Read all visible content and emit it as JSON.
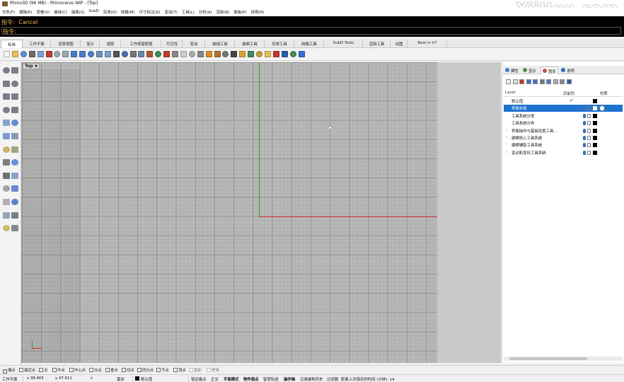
{
  "window": {
    "title": "Rhino3D (96 MB) - Rhinoceros WIP - [Top]"
  },
  "watermark": "YiiHuu.com",
  "menu": [
    "文件(F)",
    "编辑(E)",
    "查看(V)",
    "曲线(C)",
    "曲面(S)",
    "SubD",
    "实体(O)",
    "网格(M)",
    "尺寸标注(D)",
    "变动(T)",
    "工具(L)",
    "分析(A)",
    "渲染(R)",
    "面板(P)",
    "说明(H)"
  ],
  "command": {
    "history_prefix": "指令:",
    "history_text": "Cancel",
    "prompt_prefix": "指令:"
  },
  "tabs": [
    {
      "label": "标准",
      "active": true
    },
    {
      "label": "工作平面"
    },
    {
      "label": "设置视图"
    },
    {
      "label": "显示"
    },
    {
      "label": "选取"
    },
    {
      "label": "工作视窗配置"
    },
    {
      "label": "可见性"
    },
    {
      "label": "变动"
    },
    {
      "label": "曲线工具"
    },
    {
      "label": "曲面工具"
    },
    {
      "label": "实体工具"
    },
    {
      "label": "网格工具"
    },
    {
      "label": "SubD Tools"
    },
    {
      "label": "渲染工具"
    },
    {
      "label": "出图"
    },
    {
      "label": "New in V7"
    }
  ],
  "viewport": {
    "name": "Top"
  },
  "panel": {
    "tabs": [
      {
        "label": "属性",
        "color": "#3d7fcf"
      },
      {
        "label": "显示",
        "color": "#5a8b3a"
      },
      {
        "label": "图层",
        "color": "#c0504d",
        "active": true
      },
      {
        "label": "说明",
        "color": "#2a6db5"
      }
    ],
    "header": {
      "layer": "Layer",
      "current": "目前的",
      "material": "材质"
    },
    "layers": [
      {
        "name": "默认值",
        "current": true,
        "expand": ""
      },
      {
        "name": "界面布局",
        "selected": true,
        "expand": ""
      },
      {
        "name": "工具系统分类",
        "expand": ""
      },
      {
        "name": "工具系统分布",
        "expand": ""
      },
      {
        "name": "界面操作与基础设置工具...",
        "expand": "›"
      },
      {
        "name": "建模核心工具系统",
        "expand": "›"
      },
      {
        "name": "建模辅助工具系统",
        "expand": "›"
      },
      {
        "name": "变动和变形工具系统",
        "expand": "›"
      }
    ],
    "current_mark": "✓"
  },
  "osnap": [
    {
      "label": "端点",
      "checked": true
    },
    {
      "label": "最近点"
    },
    {
      "label": "点"
    },
    {
      "label": "中点"
    },
    {
      "label": "中心点"
    },
    {
      "label": "交点"
    },
    {
      "label": "垂点"
    },
    {
      "label": "切点"
    },
    {
      "label": "四分点"
    },
    {
      "label": "节点"
    },
    {
      "label": "顶点"
    },
    {
      "label": "投影"
    },
    {
      "label": "停用"
    }
  ],
  "status": {
    "cplane": "工作平面",
    "x": "x 38.465",
    "y": "y 47.611",
    "z": "z",
    "units": "毫米",
    "layer": "默认值",
    "modes": [
      "锁定格点",
      "正交",
      "平面模式",
      "物件锁点",
      "智慧轨迹",
      "操作轴",
      "记录建构历史",
      "过滤器"
    ],
    "active_modes": [
      "平面模式",
      "物件锁点",
      "操作轴"
    ],
    "save_info": "距离上次保存的时间 (分钟): 14"
  }
}
